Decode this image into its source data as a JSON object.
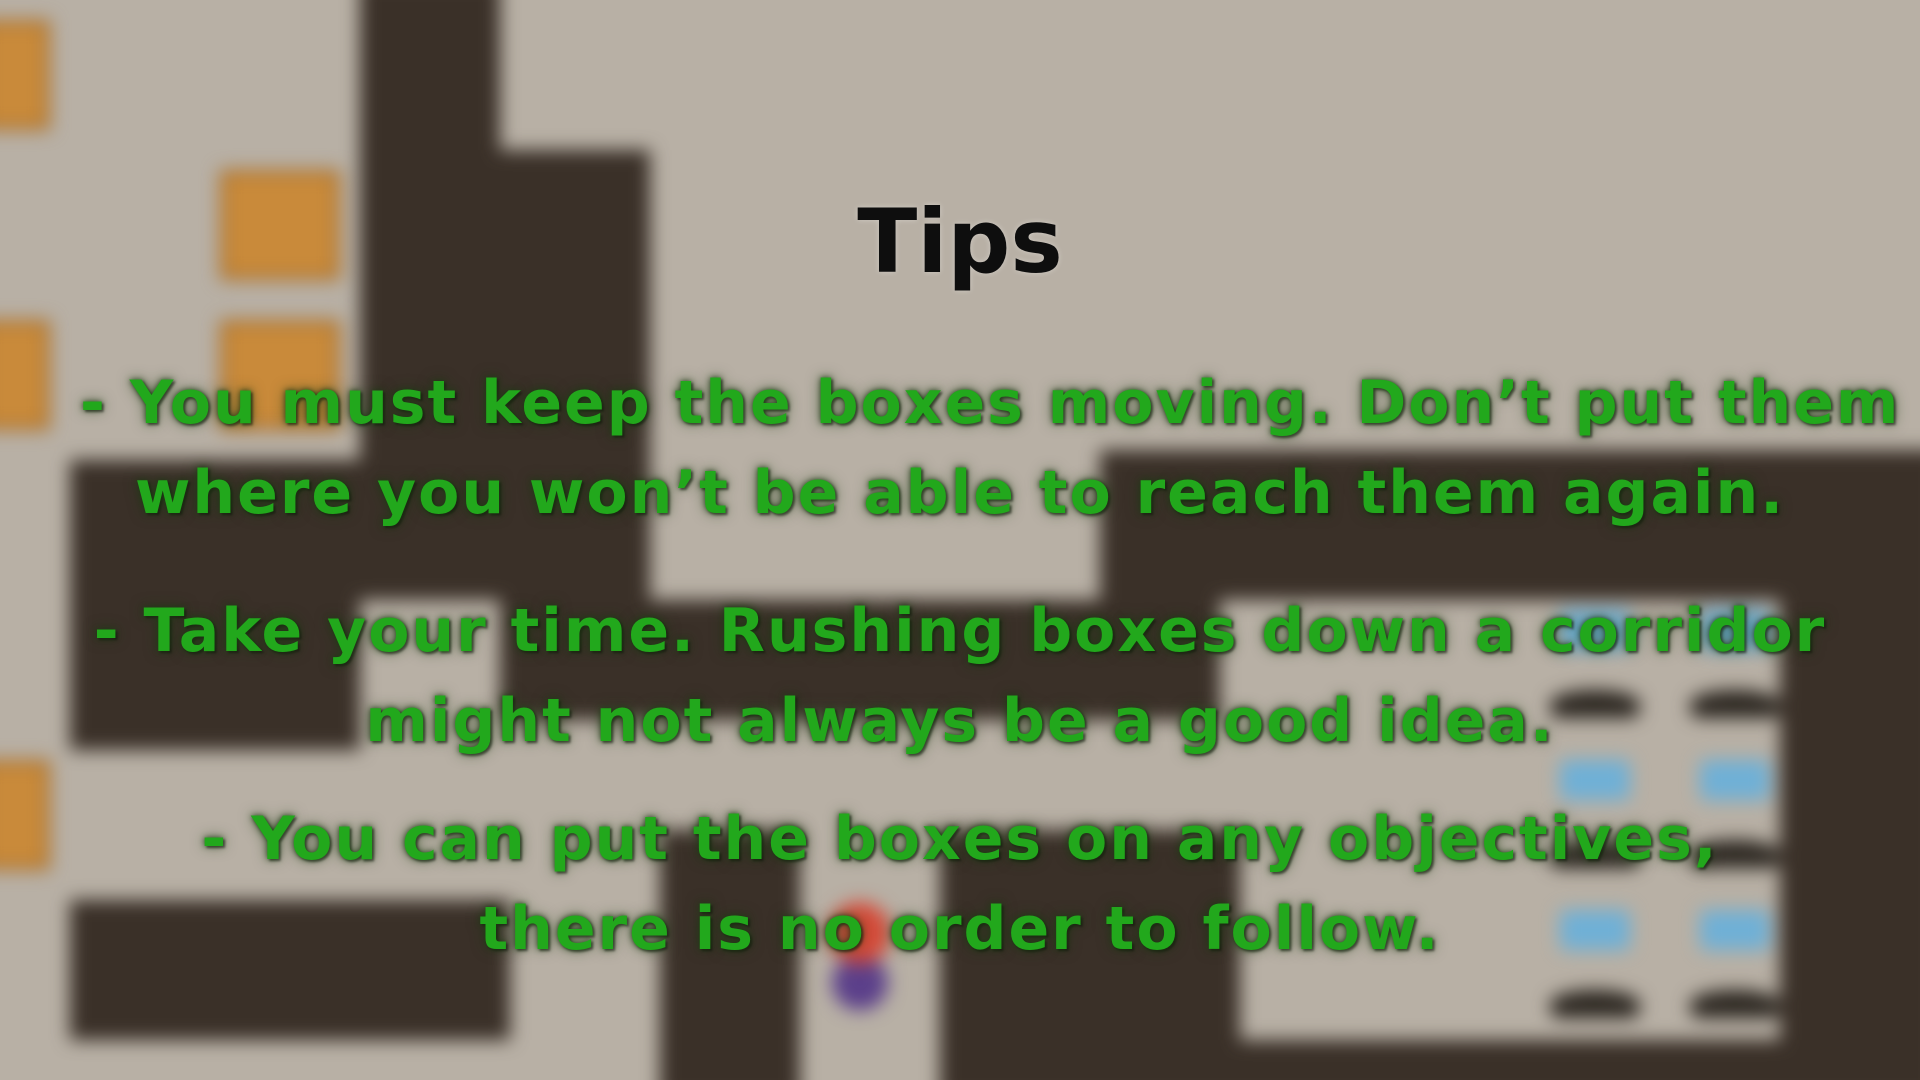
{
  "overlay": {
    "title": "Tips",
    "tips": [
      {
        "line1": "- You must keep the boxes moving. Don’t put them",
        "line2": "where you won’t be able to reach them again."
      },
      {
        "line1": "- Take your time. Rushing boxes down a corridor",
        "line2": "might not always be a good idea."
      },
      {
        "line1": "- You can put the boxes on any objectives,",
        "line2": "there is no order to follow."
      }
    ]
  },
  "colors": {
    "title": "#0e0e0e",
    "tip_text": "#22a81c",
    "floor": "#bdb5aa",
    "wall": "#3a3028",
    "crate": "#c98a3a",
    "goal_flag": "#6fb0d6"
  }
}
